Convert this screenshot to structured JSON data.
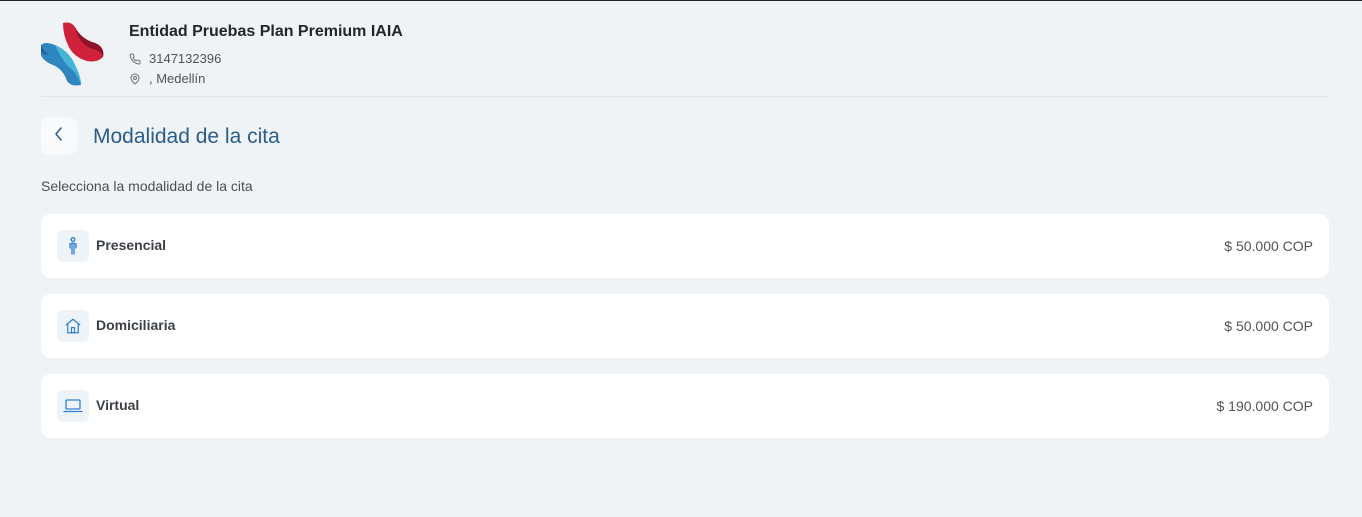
{
  "entity": {
    "name": "Entidad Pruebas Plan Premium IAIA",
    "phone": "3147132396",
    "location": ", Medellín"
  },
  "page": {
    "title": "Modalidad de la cita",
    "subtitle": "Selecciona la modalidad de la cita"
  },
  "options": [
    {
      "label": "Presencial",
      "price": "$ 50.000 COP",
      "icon": "person-icon"
    },
    {
      "label": "Domiciliaria",
      "price": "$ 50.000 COP",
      "icon": "home-icon"
    },
    {
      "label": "Virtual",
      "price": "$ 190.000 COP",
      "icon": "laptop-icon"
    }
  ],
  "colors": {
    "background": "#eff3f5",
    "title": "#2a5d8c",
    "icon_accent": "#2f7fd1",
    "logo_red": "#d0213a",
    "logo_blue": "#3aa7cf"
  }
}
